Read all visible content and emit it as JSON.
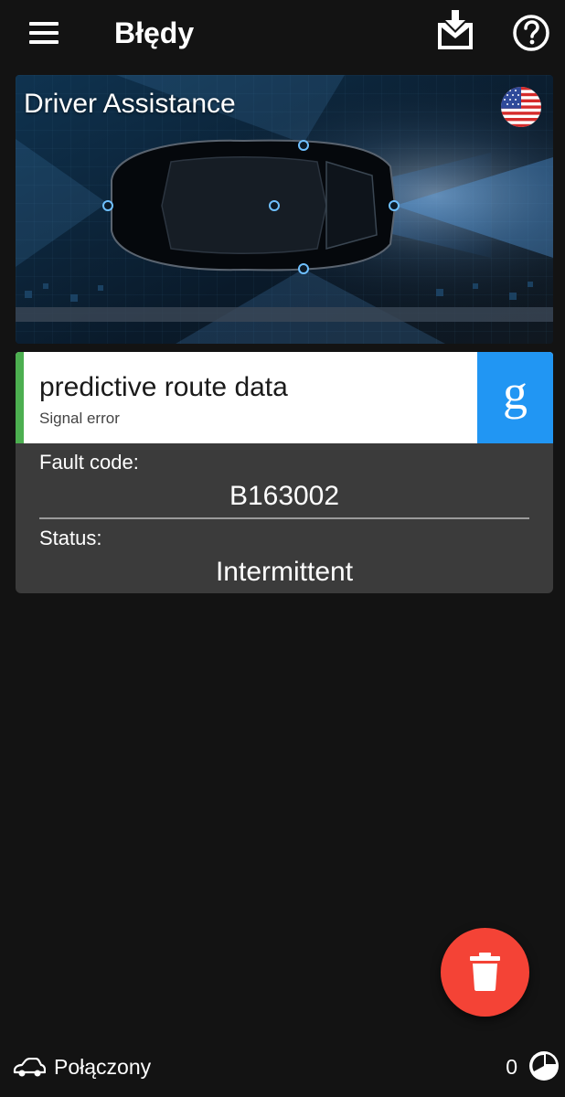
{
  "header": {
    "title": "Błędy",
    "menu_icon": "hamburger-menu-icon",
    "download_icon": "inbox-download-icon",
    "help_icon": "help-circle-icon"
  },
  "banner": {
    "title": "Driver Assistance",
    "flag_icon": "us-flag-icon"
  },
  "fault": {
    "name": "predictive route data",
    "description": "Signal error",
    "severity_color": "#4caf50",
    "search_icon": "google-g-icon",
    "search_label": "g",
    "code_label": "Fault code:",
    "code_value": "B163002",
    "status_label": "Status:",
    "status_value": "Intermittent"
  },
  "fab": {
    "icon": "trash-icon",
    "color": "#f44336"
  },
  "footer": {
    "car_icon": "car-icon",
    "connection_status": "Połączony",
    "counter": "0",
    "counter_icon": "pie-chart-icon"
  },
  "colors": {
    "background": "#131313",
    "card_body": "#3b3b3b",
    "accent_blue": "#2196f3"
  }
}
